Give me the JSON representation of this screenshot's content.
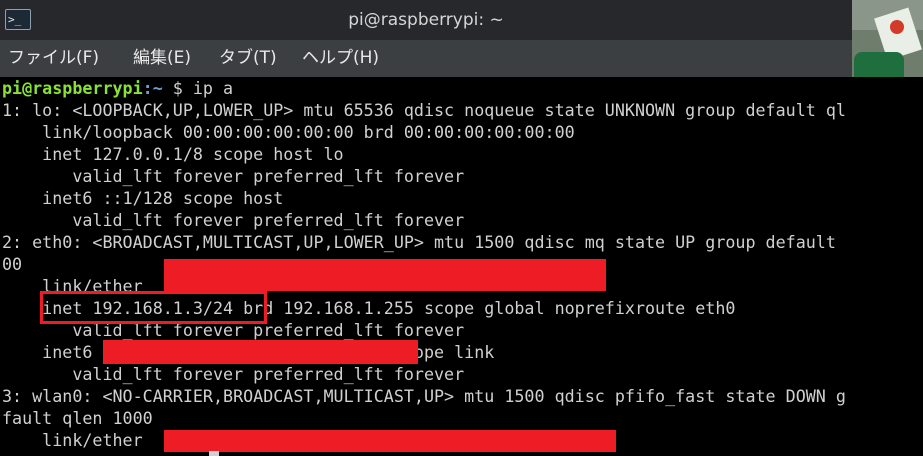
{
  "window": {
    "title": "pi@raspberrypi: ~",
    "icon": "terminal-icon",
    "icon_glyph": ">_"
  },
  "menu": {
    "items": [
      {
        "label": "ファイル(F)"
      },
      {
        "label": "編集(E)"
      },
      {
        "label": "タブ(T)"
      },
      {
        "label": "ヘルプ(H)"
      }
    ]
  },
  "terminal": {
    "prompt_user": "pi@raspberrypi",
    "prompt_path": ":~",
    "prompt_symbol": " $ ",
    "command": "ip a",
    "lines": [
      "1: lo: <LOOPBACK,UP,LOWER_UP> mtu 65536 qdisc noqueue state UNKNOWN group default ql",
      "    link/loopback 00:00:00:00:00:00 brd 00:00:00:00:00:00",
      "    inet 127.0.0.1/8 scope host lo",
      "       valid_lft forever preferred_lft forever",
      "    inet6 ::1/128 scope host",
      "       valid_lft forever preferred_lft forever",
      "2: eth0: <BROADCAST,MULTICAST,UP,LOWER_UP> mtu 1500 qdisc mq state UP group default",
      "00",
      "    link/ether",
      "    inet 192.168.1.3/24 brd 192.168.1.255 scope global noprefixroute eth0",
      "       valid_lft forever preferred_lft forever",
      "    inet6                              scope link",
      "       valid_lft forever preferred_lft forever",
      "3: wlan0: <NO-CARRIER,BROADCAST,MULTICAST,UP> mtu 1500 qdisc pfifo_fast state DOWN g",
      "fault qlen 1000",
      "    link/ether"
    ]
  },
  "colors": {
    "redaction": "#ee1c24",
    "prompt_user": "#8ae234",
    "prompt_path": "#729fcf"
  }
}
